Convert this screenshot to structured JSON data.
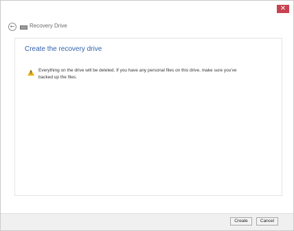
{
  "window": {
    "title": "Recovery Drive",
    "close_glyph": "✕",
    "back_glyph": "←"
  },
  "main": {
    "heading": "Create the recovery drive",
    "warning_icon": "warning-icon",
    "warning_mark": "!",
    "warning_text": "Everything on the drive will be deleted. If you have any personal files on this drive, make sure you've backed up the files."
  },
  "footer": {
    "create_label": "Create",
    "cancel_label": "Cancel"
  },
  "colors": {
    "accent": "#2f5fad",
    "close": "#c8424f",
    "warning": "#e8b21c"
  }
}
